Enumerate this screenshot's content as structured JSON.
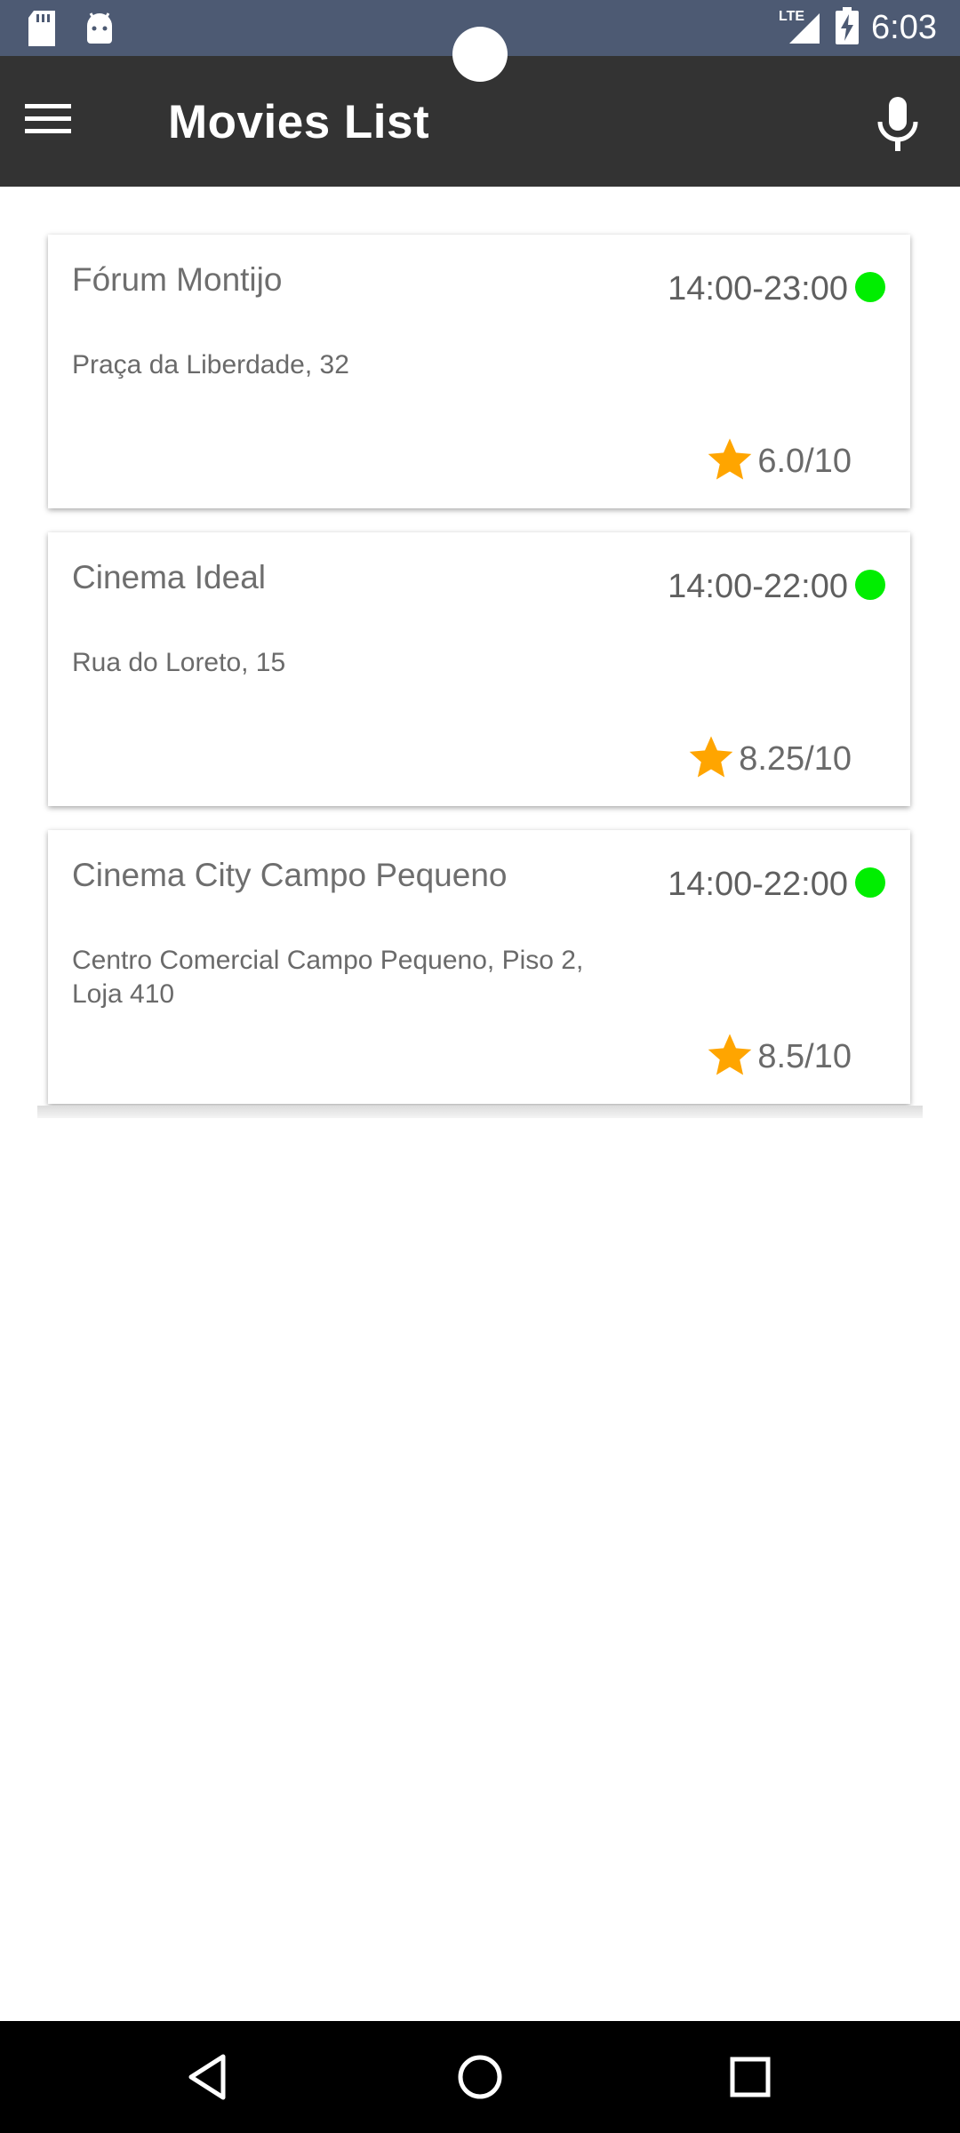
{
  "status_bar": {
    "time": "6:03",
    "network": "LTE",
    "icons": [
      "sd-card-icon",
      "android-icon",
      "signal-icon",
      "battery-charging-icon"
    ]
  },
  "app_bar": {
    "title": "Movies List",
    "menu_icon": "hamburger-menu-icon",
    "mic_icon": "microphone-icon"
  },
  "cinemas": [
    {
      "name": "Fórum Montijo",
      "hours": "14:00-23:00",
      "address": "Praça da Liberdade, 32",
      "rating": "6.0/10",
      "status_color": "#00ee00"
    },
    {
      "name": "Cinema Ideal",
      "hours": "14:00-22:00",
      "address": "Rua do Loreto, 15",
      "rating": "8.25/10",
      "status_color": "#00ee00"
    },
    {
      "name": "Cinema City Campo Pequeno",
      "hours": "14:00-22:00",
      "address": "Centro Comercial Campo Pequeno, Piso 2, Loja 410",
      "rating": "8.5/10",
      "status_color": "#00ee00"
    }
  ],
  "colors": {
    "status_bar": "#4d5a73",
    "app_bar": "#333333",
    "star": "#ffa500",
    "open_status": "#00ee00"
  },
  "nav_bar": {
    "buttons": [
      "back-icon",
      "home-icon",
      "recents-icon"
    ]
  }
}
